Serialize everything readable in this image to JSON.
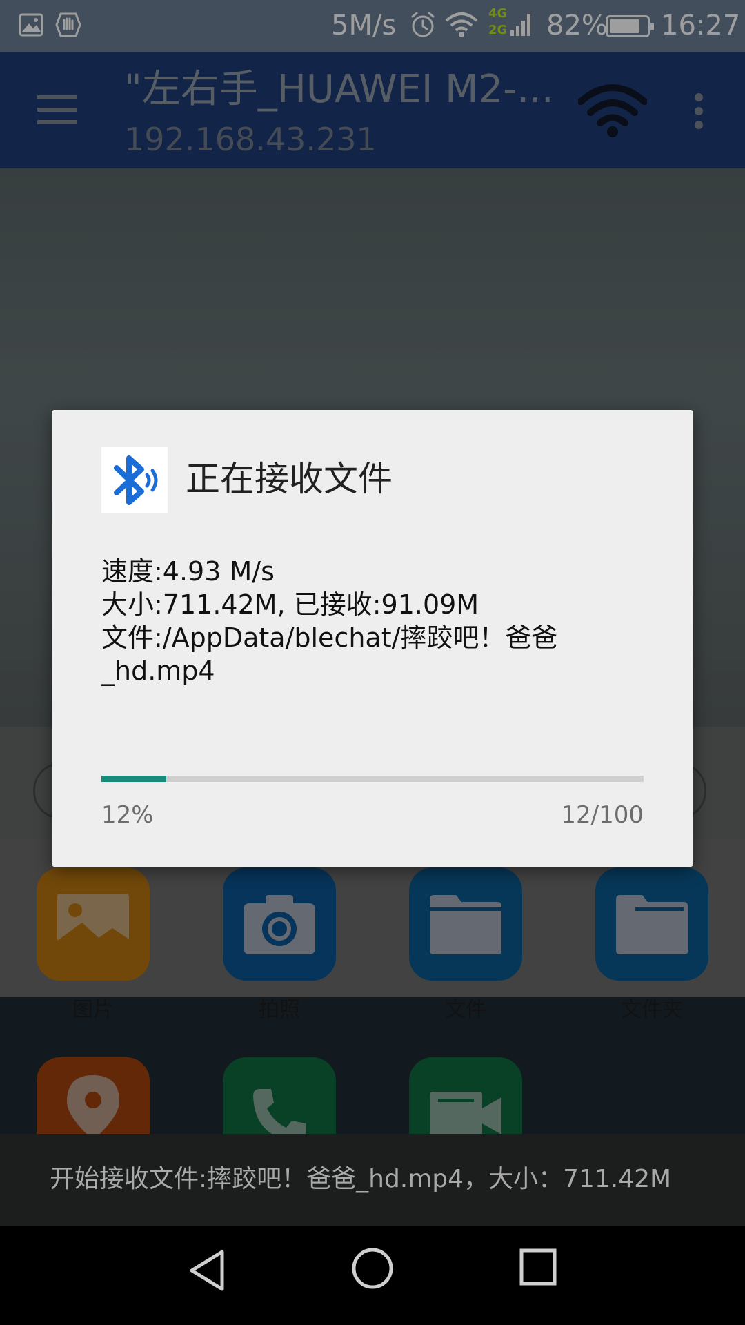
{
  "status_bar": {
    "speed": "5M/s",
    "battery_percent": "82%",
    "time": "16:27",
    "network_badge_top": "4G",
    "network_badge_bottom": "2G",
    "icons": [
      "gallery-icon",
      "hand-icon",
      "alarm-icon",
      "wifi-icon",
      "signal-icon",
      "battery-icon"
    ],
    "battery_level": 0.82
  },
  "app_bar": {
    "title": "\"左右手_HUAWEI M2-...",
    "subtitle": "192.168.43.231",
    "icons": [
      "menu-icon",
      "wifi-icon",
      "more-vert-icon"
    ]
  },
  "grid": {
    "items": [
      {
        "label": "图片",
        "icon": "image-icon",
        "color": "#b7740f"
      },
      {
        "label": "拍照",
        "icon": "camera-icon",
        "color": "#0c5591"
      },
      {
        "label": "文件",
        "icon": "file-icon",
        "color": "#0c5a8e"
      },
      {
        "label": "文件夹",
        "icon": "folder-icon",
        "color": "#0c5a8e"
      },
      {
        "label": "",
        "icon": "location-icon",
        "color": "#a0420e"
      },
      {
        "label": "",
        "icon": "phone-icon",
        "color": "#0e6a3e"
      },
      {
        "label": "",
        "icon": "video-icon",
        "color": "#0e6a3e"
      }
    ]
  },
  "dialog": {
    "title": "正在接收文件",
    "icon": "bluetooth-icon",
    "speed_line": "速度:4.93 M/s",
    "size_line": "大小:711.42M, 已接收:91.09M",
    "file_line": "文件:/AppData/blechat/摔跤吧！爸爸\n_hd.mp4",
    "progress_percent_label": "12%",
    "progress_fraction_label": "12/100",
    "progress_value": 0.12,
    "accent_color": "#1a8a7a"
  },
  "toast": {
    "text": "开始接收文件:摔跤吧！爸爸_hd.mp4，大小：711.42M"
  },
  "nav_bar": {
    "icons": [
      "back-icon",
      "home-icon",
      "recents-icon"
    ]
  }
}
